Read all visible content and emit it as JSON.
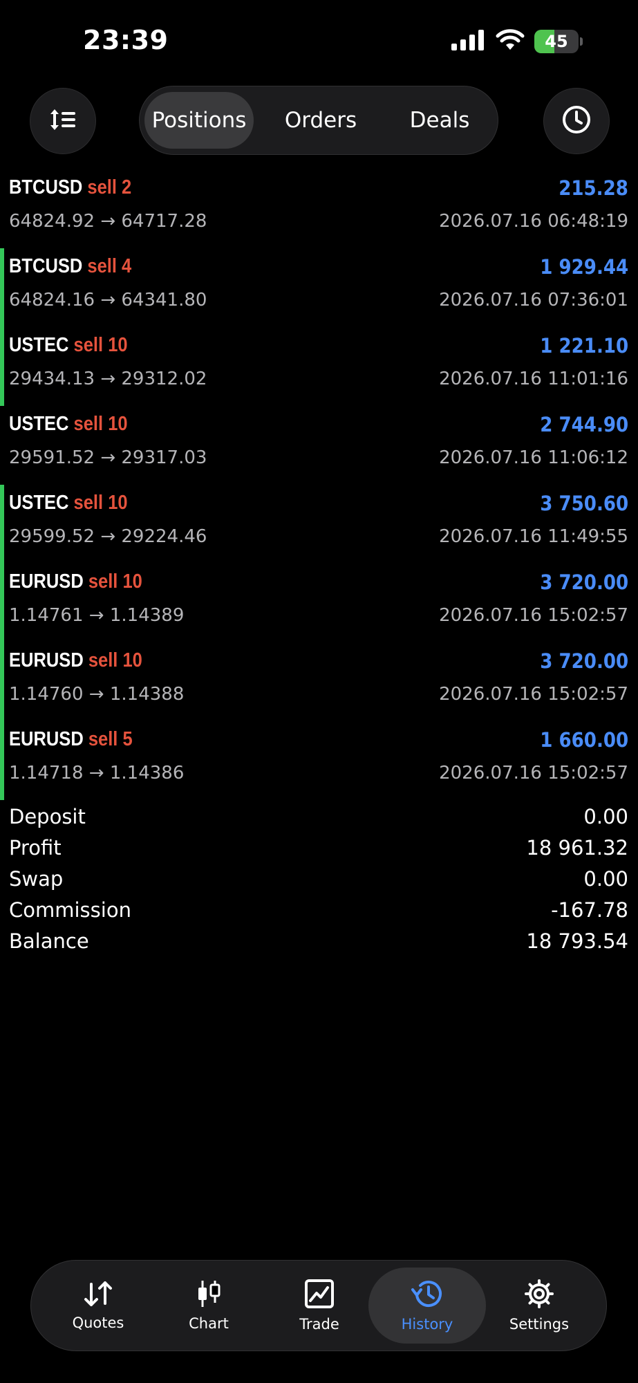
{
  "status": {
    "time": "23:39",
    "battery": "45",
    "battery_level": 0.45
  },
  "segments": {
    "positions": "Positions",
    "orders": "Orders",
    "deals": "Deals",
    "active": "positions"
  },
  "positions": [
    {
      "symbol": "BTCUSD",
      "side": "sell 2",
      "open": "64824.92",
      "close": "64717.28",
      "profit": "215.28",
      "time": "2026.07.16 06:48:19",
      "marked": false
    },
    {
      "symbol": "BTCUSD",
      "side": "sell 4",
      "open": "64824.16",
      "close": "64341.80",
      "profit": "1 929.44",
      "time": "2026.07.16 07:36:01",
      "marked": true
    },
    {
      "symbol": "USTEC",
      "side": "sell 10",
      "open": "29434.13",
      "close": "29312.02",
      "profit": "1 221.10",
      "time": "2026.07.16 11:01:16",
      "marked": true
    },
    {
      "symbol": "USTEC",
      "side": "sell 10",
      "open": "29591.52",
      "close": "29317.03",
      "profit": "2 744.90",
      "time": "2026.07.16 11:06:12",
      "marked": false
    },
    {
      "symbol": "USTEC",
      "side": "sell 10",
      "open": "29599.52",
      "close": "29224.46",
      "profit": "3 750.60",
      "time": "2026.07.16 11:49:55",
      "marked": true
    },
    {
      "symbol": "EURUSD",
      "side": "sell 10",
      "open": "1.14761",
      "close": "1.14389",
      "profit": "3 720.00",
      "time": "2026.07.16 15:02:57",
      "marked": true
    },
    {
      "symbol": "EURUSD",
      "side": "sell 10",
      "open": "1.14760",
      "close": "1.14388",
      "profit": "3 720.00",
      "time": "2026.07.16 15:02:57",
      "marked": true
    },
    {
      "symbol": "EURUSD",
      "side": "sell 5",
      "open": "1.14718",
      "close": "1.14386",
      "profit": "1 660.00",
      "time": "2026.07.16 15:02:57",
      "marked": true
    }
  ],
  "arrow": "→",
  "summary": [
    {
      "label": "Deposit",
      "value": "0.00"
    },
    {
      "label": "Profit",
      "value": "18 961.32"
    },
    {
      "label": "Swap",
      "value": "0.00"
    },
    {
      "label": "Commission",
      "value": "-167.78"
    },
    {
      "label": "Balance",
      "value": "18 793.54"
    }
  ],
  "tabs": {
    "quotes": "Quotes",
    "chart": "Chart",
    "trade": "Trade",
    "history": "History",
    "settings": "Settings",
    "active": "history"
  },
  "colors": {
    "profit": "#4a8cf7",
    "sell": "#e5533d",
    "marker": "#34c759",
    "active_tab": "#4a90ff"
  }
}
